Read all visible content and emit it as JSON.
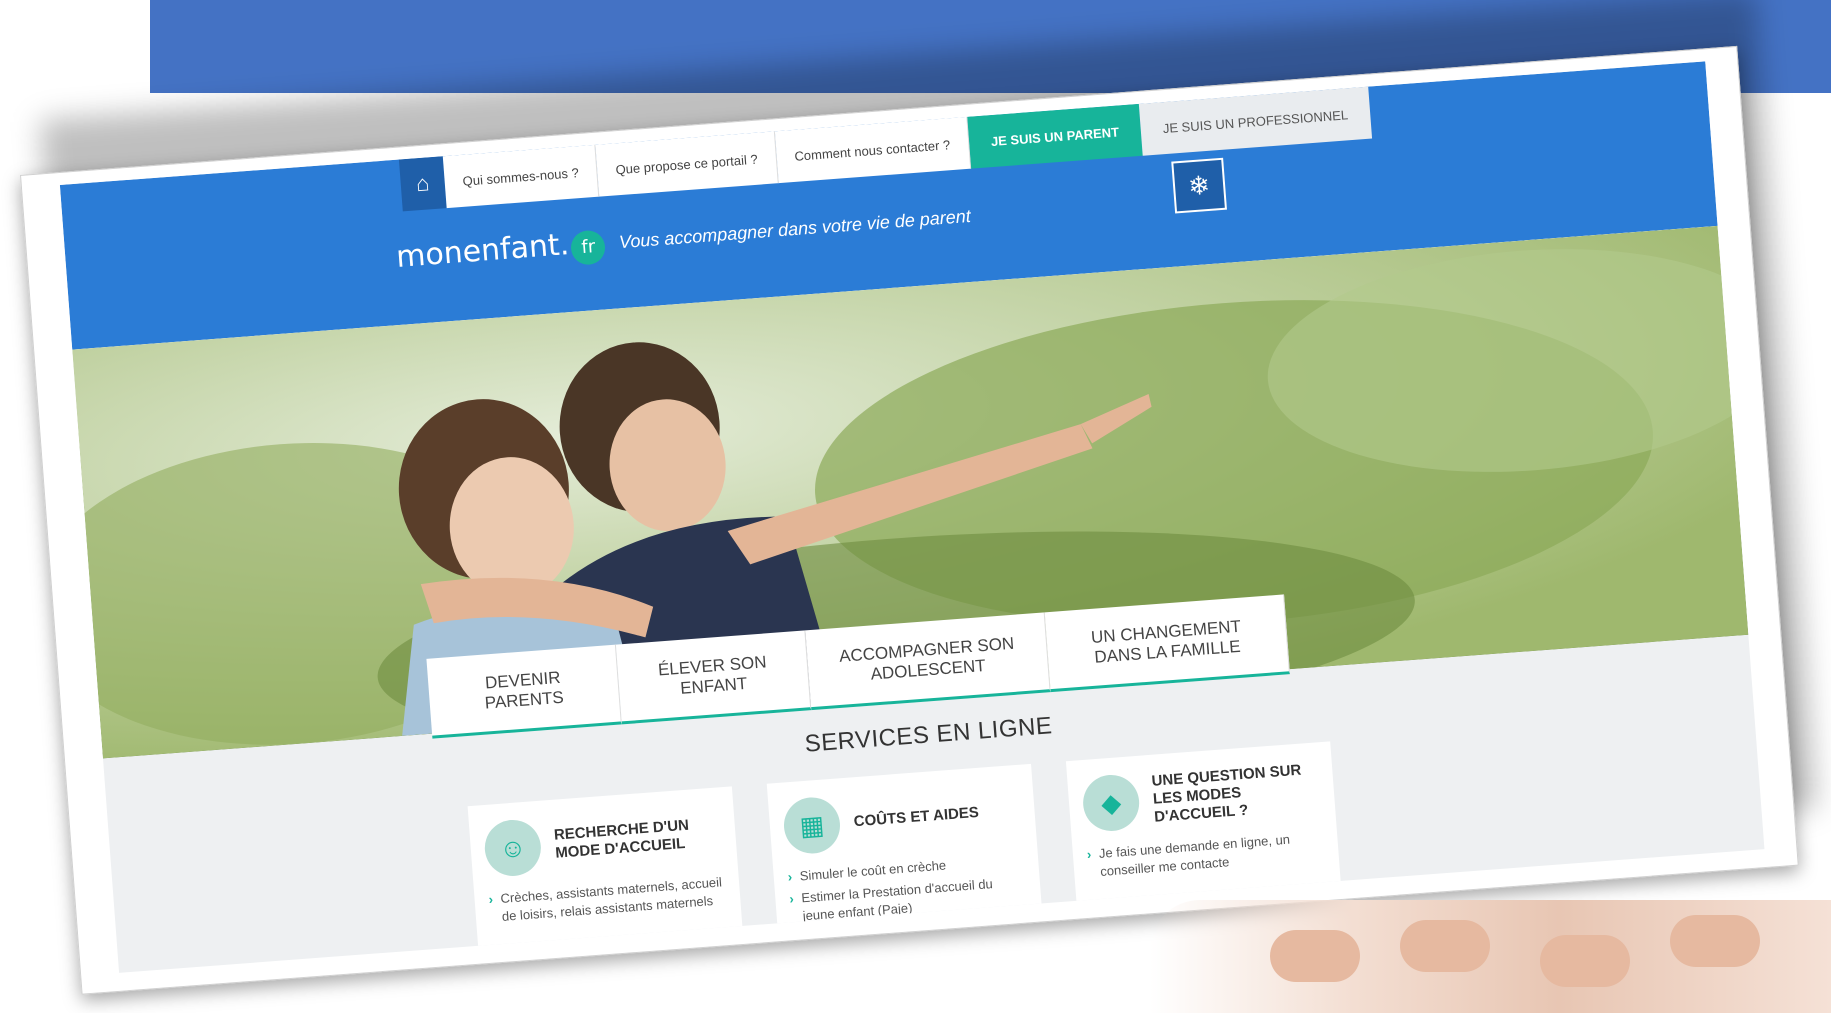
{
  "colors": {
    "slide_band": "#4472c4",
    "header_blue": "#2b7cd6",
    "accent_teal": "#17b49a"
  },
  "topnav": {
    "home_icon": "home-icon",
    "links": [
      "Qui sommes-nous ?",
      "Que propose ce portail ?",
      "Comment nous contacter ?"
    ],
    "parent_label": "JE SUIS UN PARENT",
    "pro_label": "JE SUIS UN PROFESSIONNEL"
  },
  "header": {
    "logo": "monenfant.",
    "logo_suffix": "fr",
    "tagline": "Vous accompagner dans votre vie de parent"
  },
  "tabs": [
    "DEVENIR PARENTS",
    "ÉLEVER SON ENFANT",
    "ACCOMPAGNER SON ADOLESCENT",
    "UN CHANGEMENT DANS LA FAMILLE"
  ],
  "services": {
    "title": "SERVICES EN LIGNE",
    "cards": [
      {
        "title": "RECHERCHE D'UN MODE D'ACCUEIL",
        "icon": "mother-child-icon",
        "items": [
          "Crèches, assistants maternels, accueil de loisirs, relais assistants maternels"
        ]
      },
      {
        "title": "COÛTS ET AIDES",
        "icon": "calculator-icon",
        "items": [
          "Simuler le coût en crèche",
          "Estimer la Prestation d'accueil du jeune enfant (Paje)"
        ]
      },
      {
        "title": "UNE QUESTION SUR LES MODES D'ACCUEIL ?",
        "icon": "france-map-icon",
        "items": [
          "Je fais une demande en ligne, un conseiller me contacte"
        ]
      }
    ]
  }
}
